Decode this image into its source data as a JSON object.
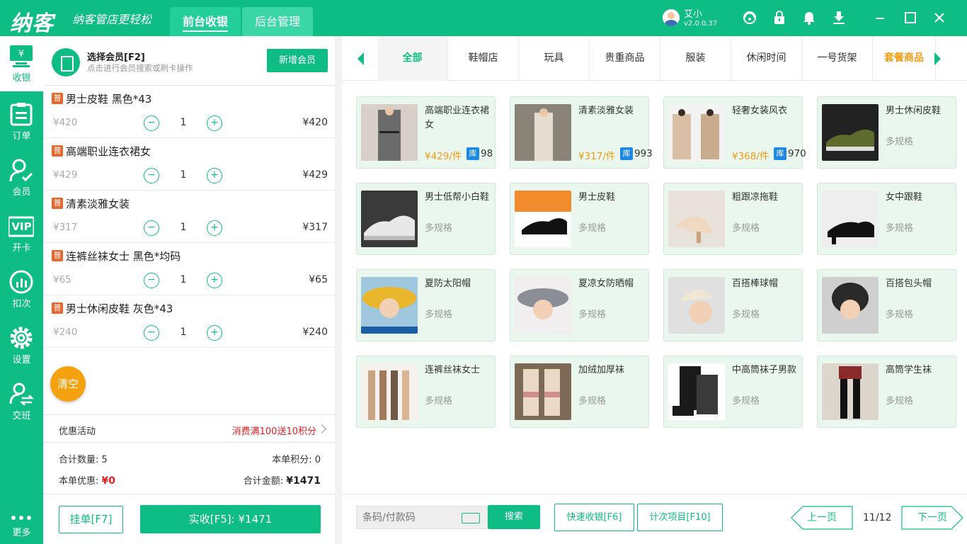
{
  "header": {
    "logo": "纳客",
    "slogan": "纳客管店更轻松",
    "tabs": [
      {
        "label": "前台收银"
      },
      {
        "label": "后台管理"
      }
    ],
    "user": {
      "name": "艾小",
      "version": "v2.0.0.37"
    }
  },
  "sidebar": {
    "items": [
      {
        "label": "收银",
        "icon": "cashier-icon"
      },
      {
        "label": "订单",
        "icon": "order-icon"
      },
      {
        "label": "会员",
        "icon": "member-icon"
      },
      {
        "label": "开卡",
        "icon": "vip-card-icon"
      },
      {
        "label": "扣次",
        "icon": "deduct-icon"
      },
      {
        "label": "设置",
        "icon": "gear-icon"
      },
      {
        "label": "交班",
        "icon": "shift-icon"
      },
      {
        "label": "更多",
        "icon": "more-icon"
      }
    ],
    "vip_text": "VIP"
  },
  "member": {
    "title": "选择会员[F2]",
    "subtitle": "点击进行会员搜索或刷卡操作",
    "add_button": "新增会员"
  },
  "cart": {
    "badge": "普",
    "items": [
      {
        "name": "男士皮鞋 黑色*43",
        "price": "¥420",
        "qty": "1",
        "total": "¥420"
      },
      {
        "name": "高端职业连衣裙女",
        "price": "¥429",
        "qty": "1",
        "total": "¥429"
      },
      {
        "name": "清素淡雅女装",
        "price": "¥317",
        "qty": "1",
        "total": "¥317"
      },
      {
        "name": "连裤丝袜女士 黑色*均码",
        "price": "¥65",
        "qty": "1",
        "total": "¥65"
      },
      {
        "name": "男士休闲皮鞋 灰色*43",
        "price": "¥240",
        "qty": "1",
        "total": "¥240"
      }
    ],
    "clear_label": "清空"
  },
  "promo": {
    "label": "优惠活动",
    "value": "消费满100送10积分"
  },
  "summary": {
    "qty_label": "合计数量:",
    "qty_value": "5",
    "points_label": "本单积分:",
    "points_value": "0",
    "discount_label": "本单优惠:",
    "discount_value": "¥0",
    "amount_label": "合计金额:",
    "amount_value": "¥1471"
  },
  "footer": {
    "hold_button": "挂单[F7]",
    "pay_button": "实收[F5]: ¥1471"
  },
  "categories": [
    {
      "label": "全部"
    },
    {
      "label": "鞋帽店"
    },
    {
      "label": "玩具"
    },
    {
      "label": "贵重商品"
    },
    {
      "label": "服装"
    },
    {
      "label": "休闲时间"
    },
    {
      "label": "一号货架"
    },
    {
      "label": "套餐商品"
    }
  ],
  "products": [
    {
      "name": "高端职业连衣裙女",
      "price": "¥429/件",
      "stock_badge": "库",
      "stock": "98"
    },
    {
      "name": "清素淡雅女装",
      "price": "¥317/件",
      "stock_badge": "库",
      "stock": "993"
    },
    {
      "name": "轻奢女装风衣",
      "price": "¥368/件",
      "stock_badge": "库",
      "stock": "970"
    },
    {
      "name": "男士休闲皮鞋",
      "spec": "多规格"
    },
    {
      "name": "男士低帮小白鞋",
      "spec": "多规格"
    },
    {
      "name": "男士皮鞋",
      "spec": "多规格"
    },
    {
      "name": "粗跟凉拖鞋",
      "spec": "多规格"
    },
    {
      "name": "女中跟鞋",
      "spec": "多规格"
    },
    {
      "name": "夏防太阳帽",
      "spec": "多规格"
    },
    {
      "name": "夏凉女防晒帽",
      "spec": "多规格"
    },
    {
      "name": "百搭棒球帽",
      "spec": "多规格"
    },
    {
      "name": "百搭包头帽",
      "spec": "多规格"
    },
    {
      "name": "连裤丝袜女士",
      "spec": "多规格"
    },
    {
      "name": "加绒加厚袜",
      "spec": "多规格"
    },
    {
      "name": "中高筒袜子男款",
      "spec": "多规格"
    },
    {
      "name": "高筒学生袜",
      "spec": "多规格"
    }
  ],
  "bottom": {
    "search_placeholder": "条码/付款码",
    "search_button": "搜索",
    "quick_button": "快速收银[F6]",
    "count_button": "计次项目[F10]",
    "prev_button": "上一页",
    "page": "11/12",
    "next_button": "下一页"
  },
  "colors": {
    "accent": "#0ebd84",
    "price": "#f39c12",
    "discount": "#e02020",
    "clear": "#f5a210"
  }
}
